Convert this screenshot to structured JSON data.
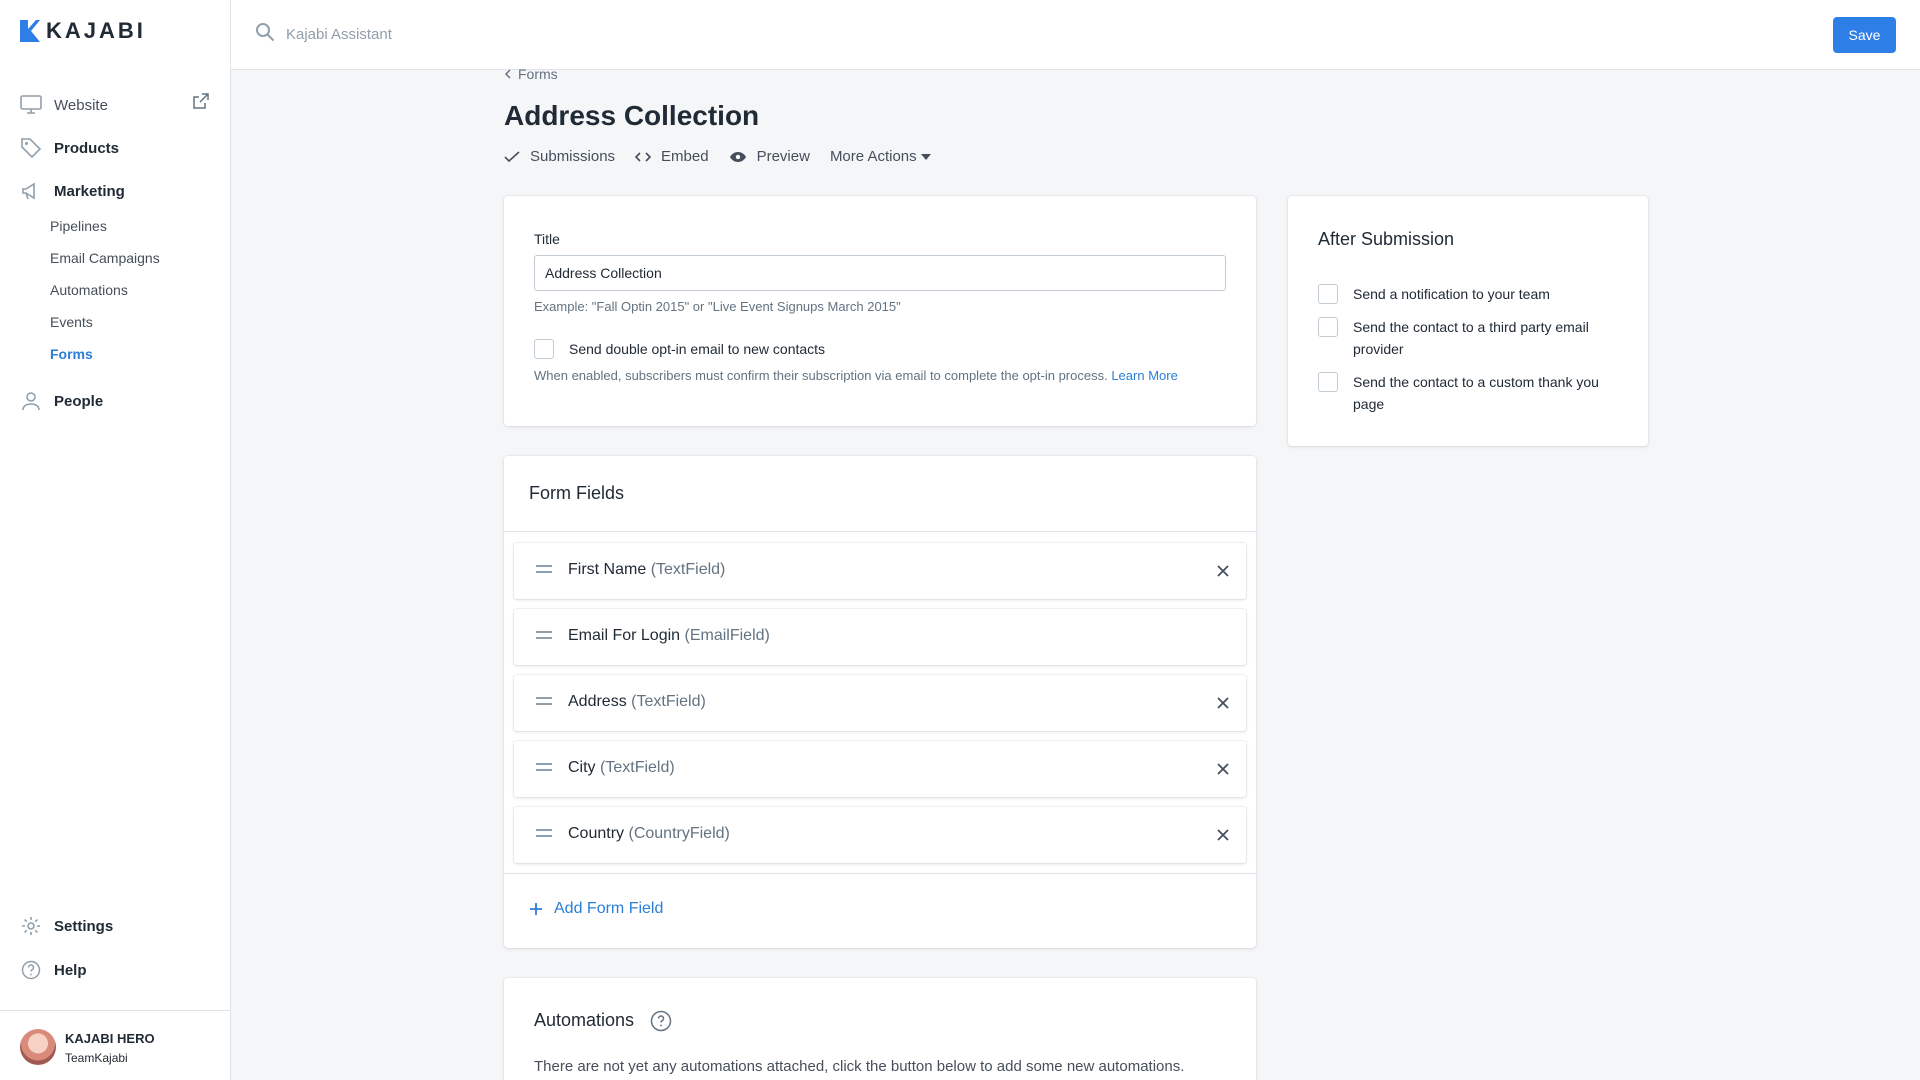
{
  "app": {
    "logo_text": "KAJABI",
    "accent_color": "#2e7ee8"
  },
  "sidebar": {
    "website": {
      "label": "Website",
      "icon": "monitor-icon"
    },
    "products": {
      "label": "Products",
      "icon": "tag-icon"
    },
    "marketing": {
      "label": "Marketing",
      "icon": "megaphone-icon"
    },
    "marketing_items": [
      {
        "label": "Pipelines"
      },
      {
        "label": "Email Campaigns"
      },
      {
        "label": "Automations"
      },
      {
        "label": "Events"
      },
      {
        "label": "Forms",
        "active": true
      }
    ],
    "people": {
      "label": "People",
      "icon": "person-icon"
    },
    "settings": {
      "label": "Settings",
      "icon": "gear-icon"
    },
    "help": {
      "label": "Help",
      "icon": "question-icon"
    },
    "user": {
      "name": "KAJABI HERO",
      "team": "TeamKajabi"
    }
  },
  "topbar": {
    "search_placeholder": "Kajabi Assistant",
    "save_label": "Save"
  },
  "breadcrumb": {
    "label": "Forms"
  },
  "page": {
    "title": "Address Collection",
    "actions": [
      {
        "label": "Submissions",
        "icon": "check-icon"
      },
      {
        "label": "Embed",
        "icon": "code-icon"
      },
      {
        "label": "Preview",
        "icon": "eye-icon"
      },
      {
        "label": "More Actions",
        "icon": "caret-down-icon"
      }
    ]
  },
  "settings_card": {
    "title_label": "Title",
    "title_value": "Address Collection",
    "title_help": "Example: \"Fall Optin 2015\" or \"Live Event Signups March 2015\"",
    "double_optin_label": "Send double opt-in email to new contacts",
    "double_optin_help": "When enabled, subscribers must confirm their subscription via email to complete the opt-in process.",
    "learn_more": "Learn More"
  },
  "after_submission": {
    "heading": "After Submission",
    "options": [
      {
        "label": "Send a notification to your team"
      },
      {
        "label": "Send the contact to a third party email provider"
      },
      {
        "label": "Send the contact to a custom thank you page"
      }
    ]
  },
  "form_fields": {
    "heading": "Form Fields",
    "fields": [
      {
        "name": "First Name",
        "type": "(TextField)",
        "removable": true
      },
      {
        "name": "Email For Login",
        "type": "(EmailField)",
        "removable": false
      },
      {
        "name": "Address",
        "type": "(TextField)",
        "removable": true
      },
      {
        "name": "City",
        "type": "(TextField)",
        "removable": true
      },
      {
        "name": "Country",
        "type": "(CountryField)",
        "removable": true
      }
    ],
    "add_label": "Add Form Field"
  },
  "automations": {
    "heading": "Automations",
    "empty_text": "There are not yet any automations attached, click the button below to add some new automations."
  }
}
